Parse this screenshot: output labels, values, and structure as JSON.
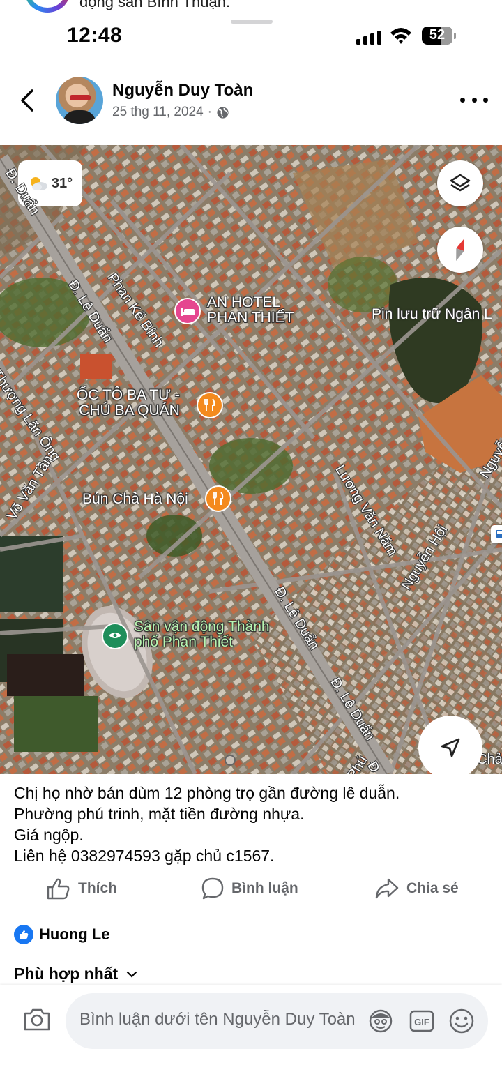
{
  "top_peek": {
    "text": "động sản Bình Thuận."
  },
  "status_bar": {
    "time": "12:48",
    "battery": "52"
  },
  "post": {
    "author": "Nguyễn Duy Toàn",
    "date": "25 thg 11, 2024",
    "separator": "·",
    "audience_icon": "globe-icon"
  },
  "map": {
    "weather": "31°",
    "places": {
      "hotel": [
        "AN HOTEL",
        "PHAN THIẾT"
      ],
      "restaurant1": [
        "ỐC TÔ BA TƯ -",
        "CHÚ BA QUÁN"
      ],
      "restaurant2": "Bún Chả Hà Nội",
      "stadium": [
        "Sân vận động Thành",
        "phố Phan Thiết"
      ],
      "storage": "Pin lưu trữ Ngân L"
    },
    "streets": {
      "le_duan_1": "Đ. Lê Duẩn",
      "le_duan_2": "Đ. Lê Duẩn",
      "le_duan_3": "Đ. Lê Duẩn",
      "le_duan_top": "Đ. Duẩn",
      "phan_ke_binh": "Phan Kế Bính",
      "hai_thuong_lan_ong": "Thượng Lãn Ông",
      "vo_van_tan": "Võ Văn Tần",
      "luong_van_nam": "Lương Văn Năm",
      "nguyen_hoi": "Nguyễn Hội",
      "nguyen_edge": "Nguyễn",
      "pho_bottom": "Phú",
      "cha_edge": "Chả",
      "d_bottom": "Đ"
    }
  },
  "caption": [
    "Chị họ nhờ bán dùm 12 phòng trọ gần đường lê duẫn.",
    "Phường phú trinh, mặt tiền đường nhựa.",
    "Giá ngộp.",
    "Liên hệ 0382974593 gặp chủ c1567."
  ],
  "actions": {
    "like": "Thích",
    "comment": "Bình luận",
    "share": "Chia sẻ"
  },
  "reactions": {
    "name": "Huong Le"
  },
  "sort": {
    "label": "Phù hợp nhất"
  },
  "comment_box": {
    "placeholder": "Bình luận dưới tên Nguyễn Duy Toàn"
  },
  "colors": {
    "fb_blue": "#1877f2",
    "secondary_text": "#65676b",
    "hotel_pin": "#e5468f",
    "food_pin": "#f48a1e",
    "park_pin": "#1e8e5a"
  }
}
